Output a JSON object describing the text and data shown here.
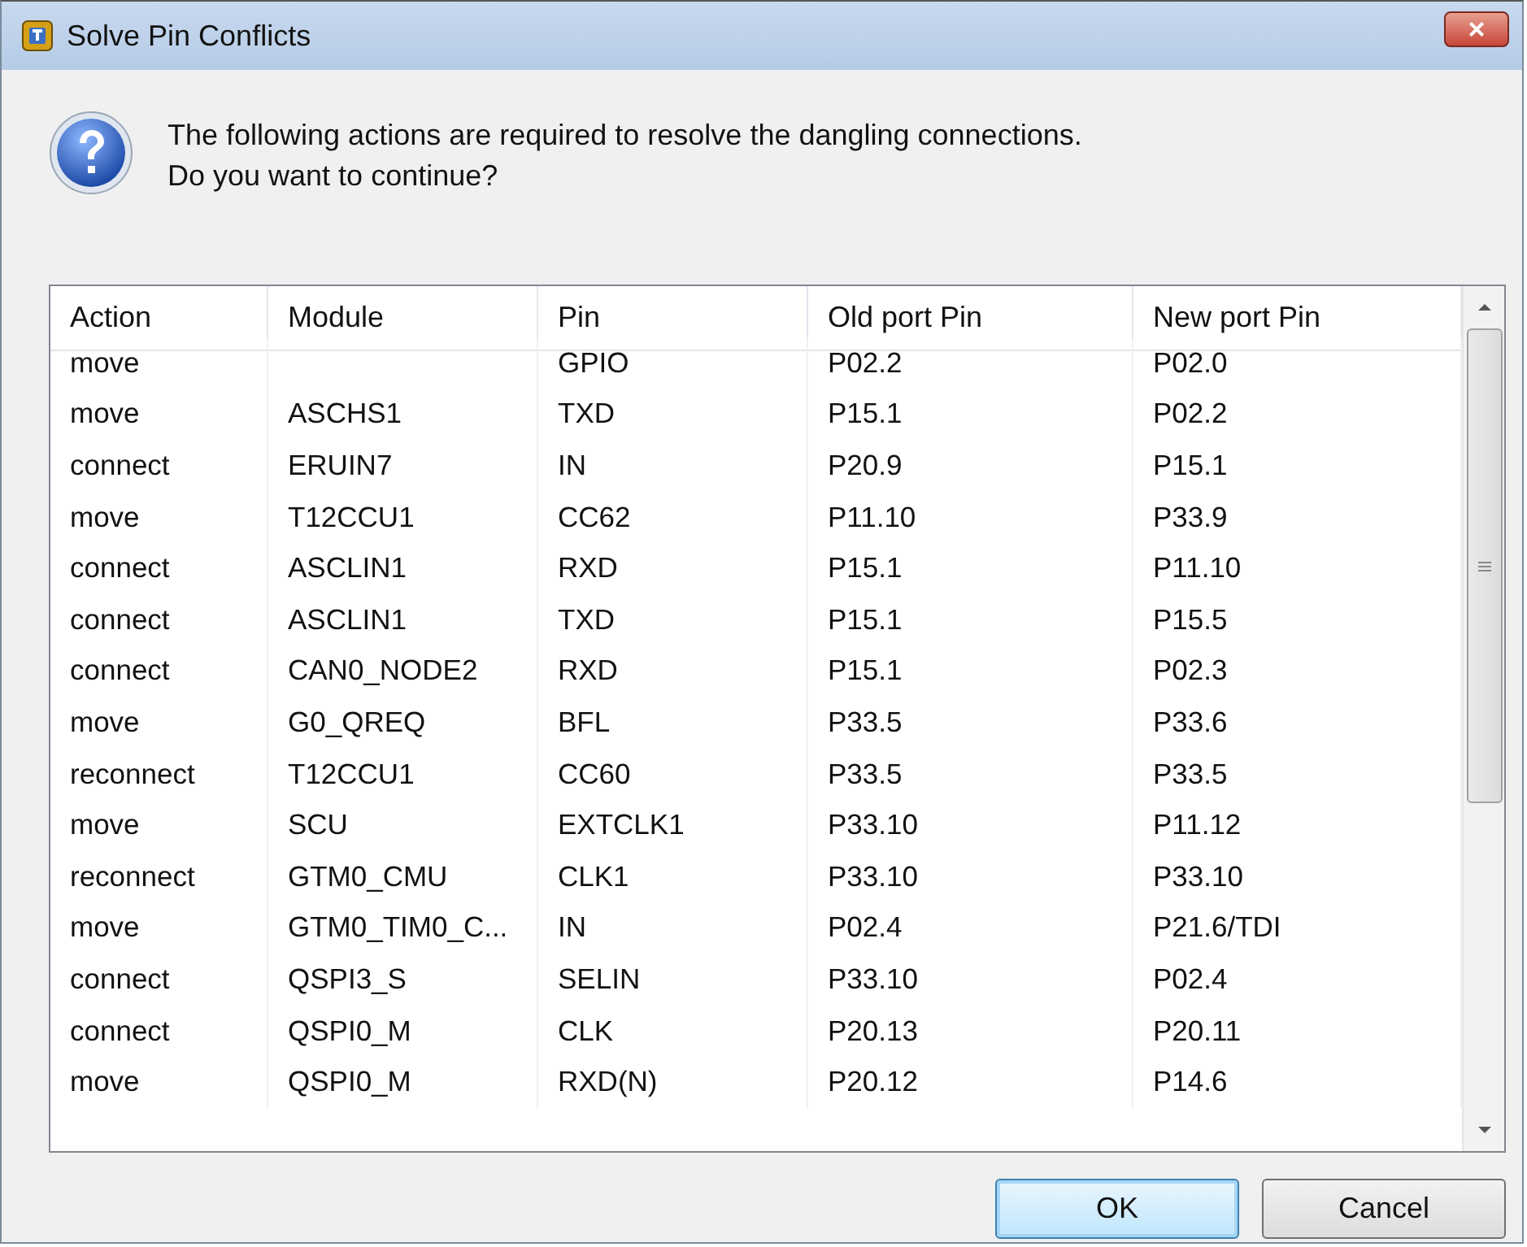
{
  "window": {
    "title": "Solve Pin Conflicts",
    "close": "×"
  },
  "message": {
    "lines": [
      "The following actions are required to resolve the dangling connections.",
      "Do you want to continue?"
    ]
  },
  "table": {
    "columns": [
      "Action",
      "Module",
      "Pin",
      "Old port Pin",
      "New port Pin"
    ],
    "rows": [
      {
        "action": "move",
        "pin": "GPIO",
        "old_port_pin": "P02.2",
        "new_port_pin": "P02.0"
      },
      {
        "action": "move",
        "module": "ASCHS1",
        "pin": "TXD",
        "old_port_pin": "P15.1",
        "new_port_pin": "P02.2"
      },
      {
        "action": "connect",
        "module": "ERUIN7",
        "pin": "IN",
        "old_port_pin": "P20.9",
        "new_port_pin": "P15.1"
      },
      {
        "action": "move",
        "module": "T12CCU1",
        "pin": "CC62",
        "old_port_pin": "P11.10",
        "new_port_pin": "P33.9"
      },
      {
        "action": "connect",
        "module": "ASCLIN1",
        "pin": "RXD",
        "old_port_pin": "P15.1",
        "new_port_pin": "P11.10"
      },
      {
        "action": "connect",
        "module": "ASCLIN1",
        "pin": "TXD",
        "old_port_pin": "P15.1",
        "new_port_pin": "P15.5"
      },
      {
        "action": "connect",
        "module": "CAN0_NODE2",
        "pin": "RXD",
        "old_port_pin": "P15.1",
        "new_port_pin": "P02.3"
      },
      {
        "action": "move",
        "module": "G0_QREQ",
        "pin": "BFL",
        "old_port_pin": "P33.5",
        "new_port_pin": "P33.6"
      },
      {
        "action": "reconnect",
        "module": "T12CCU1",
        "pin": "CC60",
        "old_port_pin": "P33.5",
        "new_port_pin": "P33.5"
      },
      {
        "action": "move",
        "module": "SCU",
        "pin": "EXTCLK1",
        "old_port_pin": "P33.10",
        "new_port_pin": "P11.12"
      },
      {
        "action": "reconnect",
        "module": "GTM0_CMU",
        "pin": "CLK1",
        "old_port_pin": "P33.10",
        "new_port_pin": "P33.10"
      },
      {
        "action": "move",
        "module": "GTM0_TIM0_C...",
        "pin": "IN",
        "old_port_pin": "P02.4",
        "new_port_pin": "P21.6/TDI"
      },
      {
        "action": "connect",
        "module": "QSPI3_S",
        "pin": "SELIN",
        "old_port_pin": "P33.10",
        "new_port_pin": "P02.4"
      },
      {
        "action": "connect",
        "module": "QSPI0_M",
        "pin": "CLK",
        "old_port_pin": "P20.13",
        "new_port_pin": "P20.11"
      },
      {
        "action": "move",
        "module": "QSPI0_M",
        "pin": "RXD(N)",
        "old_port_pin": "P20.12",
        "new_port_pin": "P14.6"
      }
    ]
  },
  "buttons": [
    {
      "label": "OK",
      "default": true
    },
    {
      "label": "Cancel",
      "default": false
    }
  ]
}
